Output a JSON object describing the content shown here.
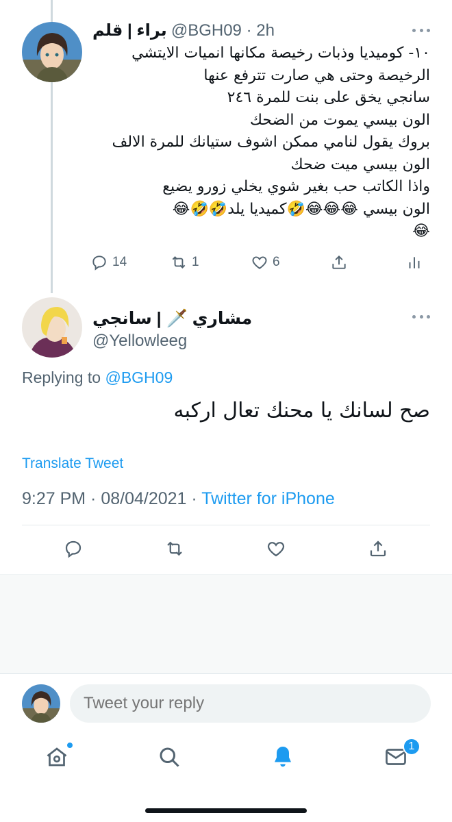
{
  "parent_tweet": {
    "display_name": "براء | قلم",
    "handle": "@BGH09",
    "time": "2h",
    "lines": [
      "١٠- كوميديا وذبات رخيصة مكانها انميات الايتشي",
      "الرخيصة وحتى هي صارت تترفع عنها",
      "سانجي يخق على بنت للمرة ٢٤٦",
      "الون بيسي يموت من الضحك",
      "بروك يقول لنامي ممكن اشوف ستيانك للمرة الالف",
      "الون بيسي ميت ضحك",
      "واذا الكاتب حب بغير شوي يخلي زورو يضيع",
      "الون بيسي 😂😂😂🤣كميديا يلد🤣🤣😂",
      "😂"
    ],
    "replies_count": "14",
    "retweets_count": "1",
    "likes_count": "6"
  },
  "reply_tweet": {
    "display_name": "مشاري 🗡️ | سانجي",
    "handle": "@Yellowleeg",
    "replying_prefix": "Replying to",
    "replying_to": "@BGH09",
    "text": "صح لسانك يا محنك تعال اركبه",
    "translate_label": "Translate Tweet",
    "timestamp": "9:27 PM · 08/04/2021 · ",
    "client": "Twitter for iPhone"
  },
  "compose": {
    "placeholder": "Tweet your reply"
  },
  "tabbar": {
    "messages_badge": "1"
  },
  "colors": {
    "accent": "#1d9bf0",
    "secondary_text": "#536471"
  }
}
